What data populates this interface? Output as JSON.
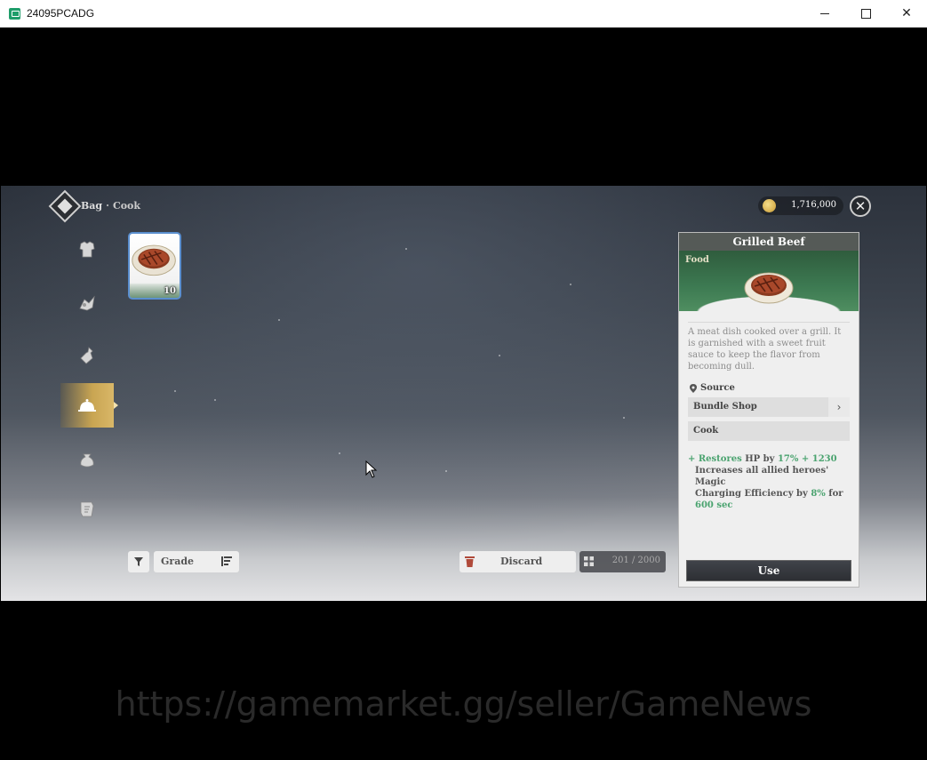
{
  "window": {
    "title": "24095PCADG",
    "minimize": "minimize",
    "maximize": "maximize",
    "close": "close"
  },
  "header": {
    "bag_label": "Bag",
    "separator": "·",
    "section_label": "Cook",
    "currency_amount": "1,716,000",
    "currency_icon": "gold-coin-icon"
  },
  "categories": [
    {
      "id": "equipment",
      "icon": "armor-icon",
      "active": false
    },
    {
      "id": "materials",
      "icon": "materials-icon",
      "active": false
    },
    {
      "id": "potions",
      "icon": "flask-icon",
      "active": false
    },
    {
      "id": "cook",
      "icon": "cloche-icon",
      "active": true
    },
    {
      "id": "bags",
      "icon": "pouch-icon",
      "active": false
    },
    {
      "id": "misc",
      "icon": "scroll-icon",
      "active": false
    }
  ],
  "inventory": {
    "items": [
      {
        "name": "Grilled Beef",
        "count": "10",
        "selected": true
      }
    ],
    "capacity_text": "201 / 2000"
  },
  "toolbar": {
    "sort_label": "Grade",
    "discard_label": "Discard"
  },
  "detail": {
    "name": "Grilled Beef",
    "category": "Food",
    "description": "A meat dish cooked over a grill. It is garnished with a sweet fruit sauce to keep the flavor from becoming dull.",
    "source_title": "Source",
    "sources": [
      "Bundle Shop",
      "Cook"
    ],
    "effect": {
      "prefix": "+",
      "verb": "Restores",
      "stat": "HP by",
      "percent": "17%",
      "flat": "+ 1230",
      "line2": "Increases all allied heroes' Magic",
      "line3a": "Charging Efficiency by",
      "boost": "8%",
      "for": "for",
      "duration": "600 sec"
    },
    "use_label": "Use"
  },
  "watermark": "https://gamemarket.gg/seller/GameNews",
  "colors": {
    "accent_gold": "#c9a552",
    "slot_border": "#5b8fcf",
    "effect_green": "#4aa36f",
    "banner_green": "#3d7a52"
  }
}
